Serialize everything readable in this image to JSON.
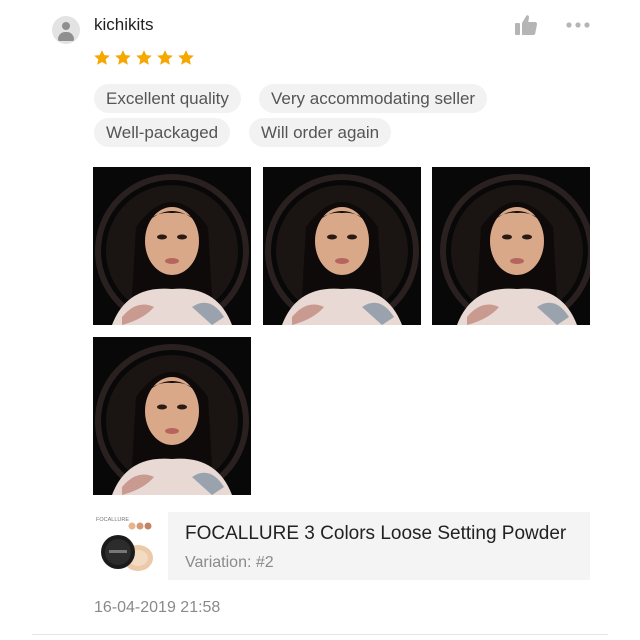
{
  "review": {
    "username": "kichikits",
    "rating": 5,
    "rating_max": 5,
    "tags": [
      "Excellent quality",
      "Very accommodating seller",
      "Well-packaged",
      "Will order again"
    ],
    "photos": [
      {
        "icon": "ring-light-selfie-photo"
      },
      {
        "icon": "ring-light-selfie-photo"
      },
      {
        "icon": "ring-light-selfie-photo"
      },
      {
        "icon": "ring-light-selfie-photo"
      }
    ],
    "product": {
      "name": "FOCALLURE 3 Colors Loose Setting Powder",
      "variation": "Variation: #2",
      "thumb_brand": "FOCALLURE"
    },
    "timestamp": "16-04-2019 21:58"
  },
  "icons": {
    "avatar": "user-avatar-icon",
    "like": "thumbs-up-icon",
    "more": "more-options-icon",
    "star": "star-icon"
  },
  "colors": {
    "star": "#f6a700",
    "tag_bg": "#f2f2f2",
    "icon_gray": "#b5b5b5",
    "product_bg": "#f4f4f4"
  }
}
